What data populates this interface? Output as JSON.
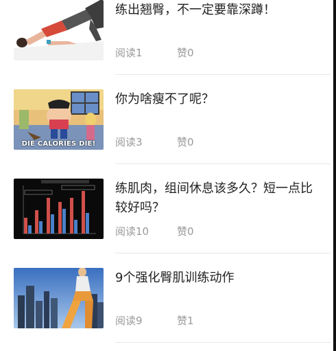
{
  "articles": [
    {
      "title": "练出翘臀，不一定要靠深蹲！",
      "read_label": "阅读1",
      "like_label": "赞0",
      "thumb_icon": "yoga-glute-bridge-photo"
    },
    {
      "title": "你为啥瘦不了呢？",
      "read_label": "阅读3",
      "like_label": "赞0",
      "thumb_icon": "cartoon-family-photo",
      "thumb_caption": "DIE CALORIES DIE!"
    },
    {
      "title": "练肌肉，组间休息该多久？短一点比较好吗？",
      "read_label": "阅读10",
      "like_label": "赞0",
      "thumb_icon": "bar-chart-photo"
    },
    {
      "title": "9个强化臀肌训练动作",
      "read_label": "阅读9",
      "like_label": "赞1",
      "thumb_icon": "city-runner-photo"
    }
  ]
}
